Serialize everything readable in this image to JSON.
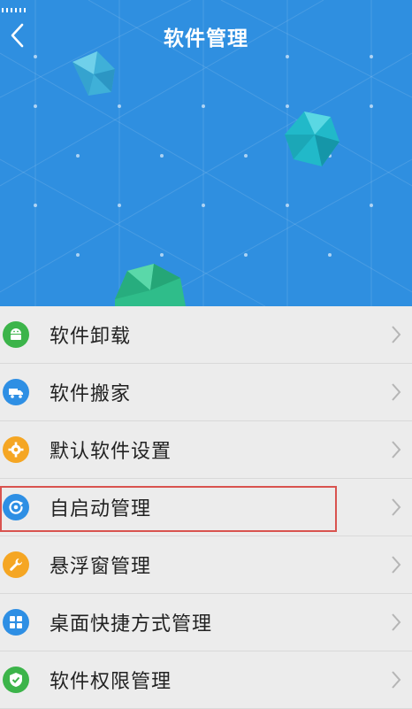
{
  "header": {
    "title": "软件管理",
    "background": "#2f8fe0"
  },
  "menu": {
    "items": [
      {
        "label": "软件卸载",
        "icon": "android-icon",
        "color": "#3cb44a"
      },
      {
        "label": "软件搬家",
        "icon": "truck-icon",
        "color": "#2e8fe4"
      },
      {
        "label": "默认软件设置",
        "icon": "gear-icon",
        "color": "#f5a623"
      },
      {
        "label": "自启动管理",
        "icon": "power-cycle-icon",
        "color": "#2e8fe4"
      },
      {
        "label": "悬浮窗管理",
        "icon": "wrench-icon",
        "color": "#f5a623"
      },
      {
        "label": "桌面快捷方式管理",
        "icon": "grid-icon",
        "color": "#2e8fe4"
      },
      {
        "label": "软件权限管理",
        "icon": "shield-icon",
        "color": "#3cb44a"
      }
    ]
  },
  "highlight_color": "#d9534f"
}
